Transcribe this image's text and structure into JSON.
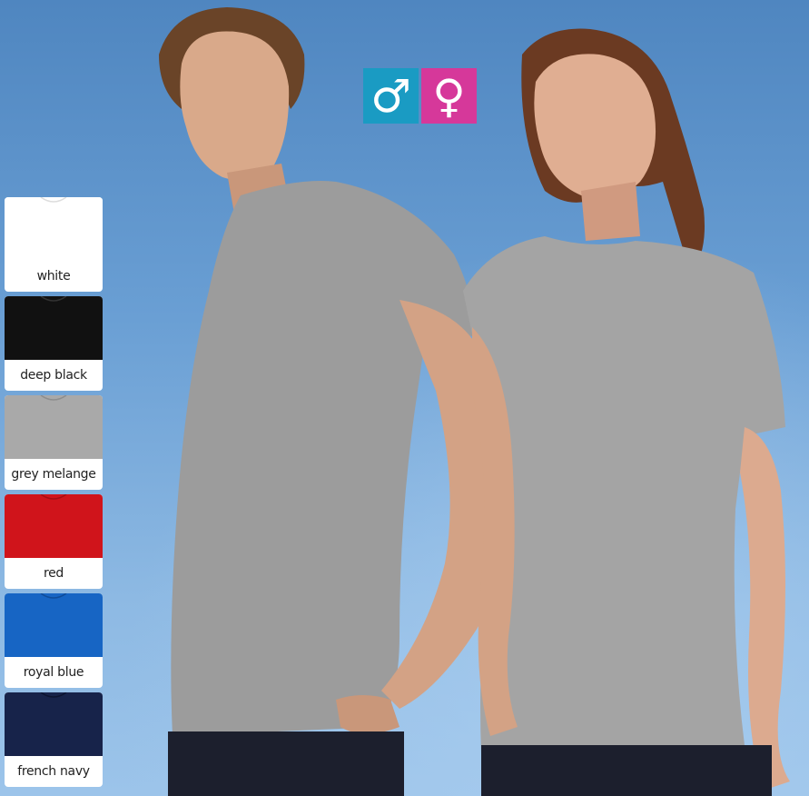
{
  "gender_icons": [
    {
      "symbol": "♂",
      "icon": "male-icon",
      "color": "#1a9bc3"
    },
    {
      "symbol": "♀",
      "icon": "female-icon",
      "color": "#d6389a"
    }
  ],
  "colors": [
    {
      "label": "white",
      "hex": "#ffffff"
    },
    {
      "label": "deep black",
      "hex": "#111111"
    },
    {
      "label": "grey melange",
      "hex": "#a9a9a9"
    },
    {
      "label": "red",
      "hex": "#d0141b"
    },
    {
      "label": "royal blue",
      "hex": "#1765c4"
    },
    {
      "label": "french navy",
      "hex": "#17234a"
    }
  ]
}
